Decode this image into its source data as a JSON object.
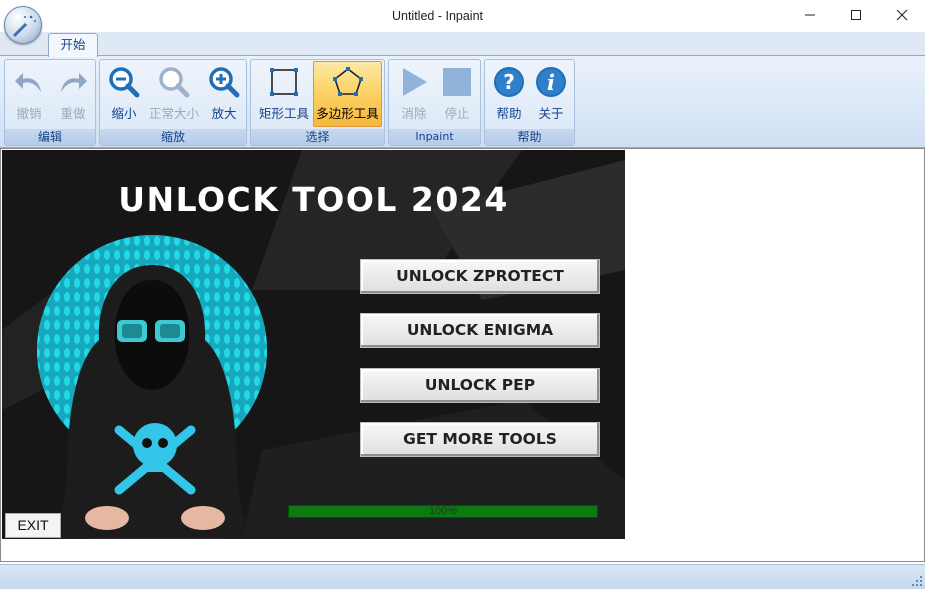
{
  "window": {
    "title": "Untitled - Inpaint"
  },
  "tabs": [
    {
      "label": "开始"
    }
  ],
  "ribbon": {
    "groups": [
      {
        "title": "编辑",
        "buttons": [
          {
            "label": "撤销",
            "icon": "undo-icon",
            "enabled": false
          },
          {
            "label": "重做",
            "icon": "redo-icon",
            "enabled": false
          }
        ]
      },
      {
        "title": "缩放",
        "buttons": [
          {
            "label": "缩小",
            "icon": "zoom-out-icon",
            "enabled": true
          },
          {
            "label": "正常大小",
            "icon": "zoom-normal-icon",
            "enabled": false
          },
          {
            "label": "放大",
            "icon": "zoom-in-icon",
            "enabled": true
          }
        ]
      },
      {
        "title": "选择",
        "buttons": [
          {
            "label": "矩形工具",
            "icon": "rectangle-tool-icon",
            "enabled": true
          },
          {
            "label": "多边形工具",
            "icon": "polygon-tool-icon",
            "enabled": true,
            "selected": true
          }
        ]
      },
      {
        "title": "Inpaint",
        "buttons": [
          {
            "label": "消除",
            "icon": "play-icon",
            "enabled": false
          },
          {
            "label": "停止",
            "icon": "stop-icon",
            "enabled": false
          }
        ]
      },
      {
        "title": "帮助",
        "buttons": [
          {
            "label": "帮助",
            "icon": "help-icon",
            "enabled": true
          },
          {
            "label": "关于",
            "icon": "info-icon",
            "enabled": true
          }
        ]
      }
    ]
  },
  "image": {
    "title": "UNLOCK TOOL 2024",
    "buttons": [
      {
        "label": "UNLOCK ZPROTECT"
      },
      {
        "label": "UNLOCK ENIGMA"
      },
      {
        "label": "UNLOCK PEP"
      },
      {
        "label": "GET MORE TOOLS"
      }
    ],
    "progress": {
      "text": "100%",
      "value": 1.0
    },
    "exit_label": "EXIT",
    "binary_text": "011010100110",
    "hacker_icon": "hooded-hacker-icon"
  },
  "colors": {
    "ribbon_text": "#15428b",
    "accent_blue": "#1f6fb8",
    "selected_tool": "#fbd36a",
    "progress_green": "#0c7a12",
    "circle_cyan": "#1fc9d8"
  }
}
